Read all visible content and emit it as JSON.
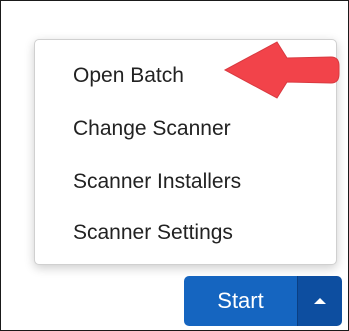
{
  "menu": {
    "items": [
      {
        "label": "Open Batch"
      },
      {
        "label": "Change Scanner"
      },
      {
        "label": "Scanner Installers"
      },
      {
        "label": "Scanner Settings"
      }
    ]
  },
  "annotation": {
    "arrow_color": "#f2434a",
    "points_to": "Open Batch"
  },
  "button": {
    "start_label": "Start",
    "caret_icon": "caret-up-icon",
    "color": "#1565c0"
  }
}
